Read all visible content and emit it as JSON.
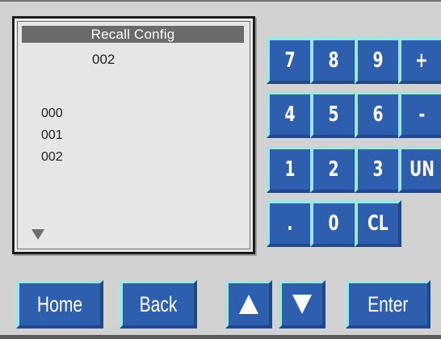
{
  "lcd": {
    "title": "Recall Config",
    "current_value": "002",
    "list": [
      "000",
      "001",
      "002"
    ],
    "scroll_icon": "triangle-down-icon"
  },
  "keypad": {
    "keys": [
      "7",
      "8",
      "9",
      "+",
      "4",
      "5",
      "6",
      "-",
      "1",
      "2",
      "3",
      "UN",
      ".",
      "0",
      "CL"
    ]
  },
  "buttons": {
    "home": "Home",
    "back": "Back",
    "up_icon": "arrow-up-icon",
    "down_icon": "arrow-down-icon",
    "enter": "Enter"
  },
  "colors": {
    "background": "#d2d2d2",
    "key_face": "#2d5fae",
    "key_highlight": "#9ee6e6",
    "lcd_background": "#e6e6e6",
    "lcd_title_bar": "#6a6a6a"
  }
}
